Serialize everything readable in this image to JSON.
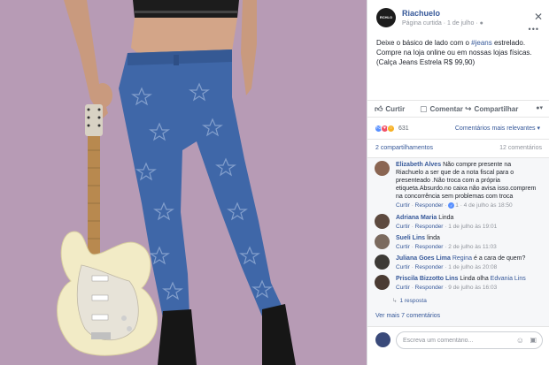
{
  "post": {
    "page_name": "Riachuelo",
    "page_logo_text": "RCHLO",
    "page_type": "Página curtida",
    "date": "1 de julho",
    "text_before_hashtag": "Deixe o básico de lado com o ",
    "hashtag": "#jeans",
    "text_after_hashtag": " estrelado.",
    "text_line2": "Compre na loja online ou em nossas lojas físicas.",
    "text_line3": "(Calça Jeans Estrela R$ 99,90)"
  },
  "actions": {
    "like": "Curtir",
    "comment": "Comentar",
    "share": "Compartilhar"
  },
  "reactions": {
    "count": "631",
    "sort_label": "Comentários mais relevantes"
  },
  "stats": {
    "shares": "2 compartilhamentos",
    "comments": "12 comentários"
  },
  "comment_actions": {
    "like": "Curtir",
    "reply": "Responder"
  },
  "comments": [
    {
      "author": "Elizabeth Alves",
      "lines": [
        "Não compre presente na",
        "Riachuelo a ser que de a nota fiscal para o",
        "presenteado .Não troca com a própria",
        "etiqueta.Absurdo.no caixa não avisa isso.comprem",
        "na concorrência sem problemas com troca"
      ],
      "likes": "1",
      "time": "4 de julho às 18:50"
    },
    {
      "author": "Adriana Maria",
      "text": "Linda",
      "time": "1 de julho às 19:01"
    },
    {
      "author": "Sueli Lins",
      "text": "linda",
      "time": "2 de julho às 11:03"
    },
    {
      "author": "Juliana Goes Lima",
      "mention": "Regina",
      "text": "é a cara de quem?",
      "time": "1 de julho às 20:08"
    },
    {
      "author": "Priscila Bizzotto Lins",
      "text": "Linda olha",
      "mention": "Edvania Lins",
      "time": "9 de julho às 16:03"
    }
  ],
  "replies_label": "1 resposta",
  "view_more": "Ver mais 7 comentários",
  "composer": {
    "placeholder": "Escreva um comentário..."
  },
  "colors": {
    "link": "#365899",
    "photo_bg": "#b79bb5",
    "jeans": "#3f67a8"
  }
}
